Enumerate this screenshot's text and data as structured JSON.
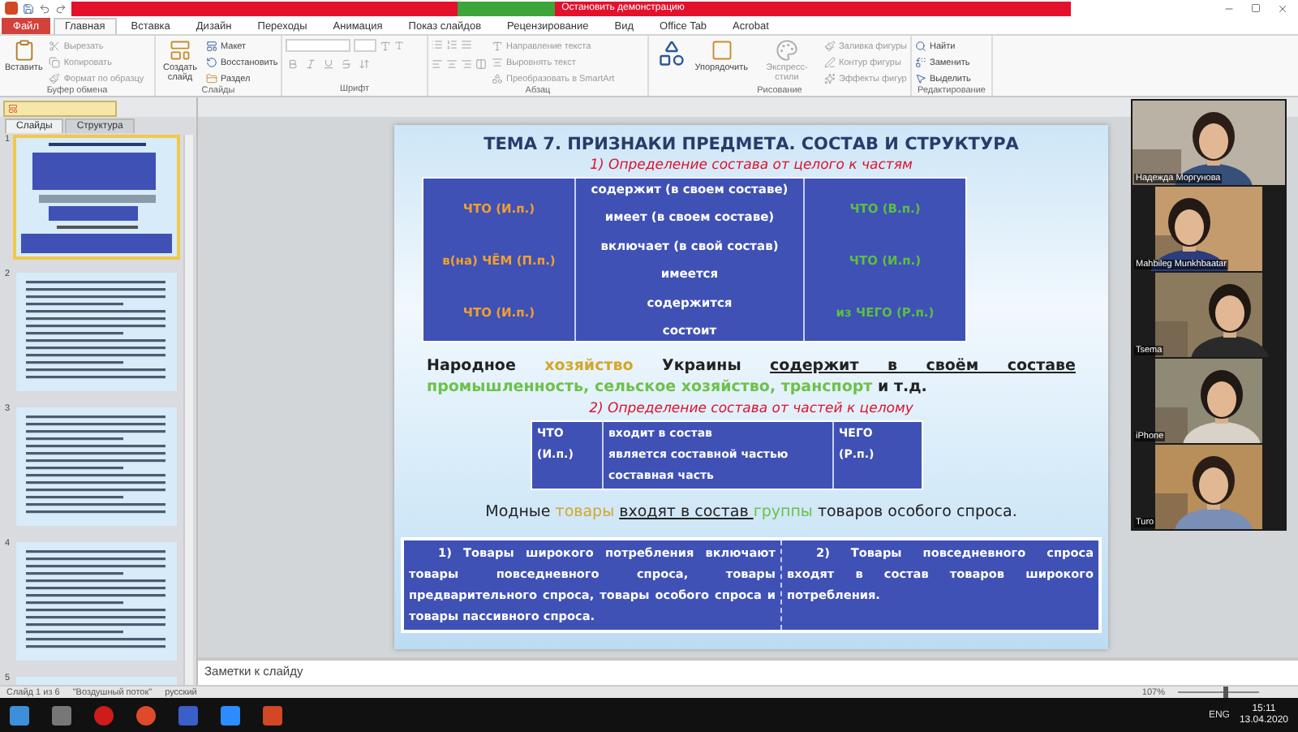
{
  "title_bar": {
    "share_label": "Остановить демонстрацию"
  },
  "ribbon": {
    "tabs": [
      {
        "label": "Файл",
        "selected": false,
        "kind": "file"
      },
      {
        "label": "Главная",
        "selected": true,
        "kind": "tab"
      },
      {
        "label": "Вставка",
        "selected": false,
        "kind": "tab"
      },
      {
        "label": "Дизайн",
        "selected": false,
        "kind": "tab"
      },
      {
        "label": "Переходы",
        "selected": false,
        "kind": "tab"
      },
      {
        "label": "Анимация",
        "selected": false,
        "kind": "tab"
      },
      {
        "label": "Показ слайдов",
        "selected": false,
        "kind": "tab"
      },
      {
        "label": "Рецензирование",
        "selected": false,
        "kind": "tab"
      },
      {
        "label": "Вид",
        "selected": false,
        "kind": "tab"
      },
      {
        "label": "Office Tab",
        "selected": false,
        "kind": "tab"
      },
      {
        "label": "Acrobat",
        "selected": false,
        "kind": "tab"
      }
    ],
    "clipboard": {
      "caption": "Буфер обмена",
      "paste": "Вставить",
      "cut": "Вырезать",
      "copy": "Копировать",
      "format": "Формат по образцу"
    },
    "slides": {
      "caption": "Слайды",
      "new_slide": "Создать слайд",
      "layout": "Макет",
      "reset": "Восстановить",
      "section": "Раздел"
    },
    "font": {
      "caption": "Шрифт"
    },
    "paragraph": {
      "caption": "Абзац",
      "direction": "Направление текста",
      "align": "Выровнять текст",
      "smartart": "Преобразовать в SmartArt"
    },
    "drawing": {
      "caption": "Рисование",
      "arrange": "Упорядочить",
      "styles": "Экспресс-стили",
      "fill": "Заливка фигуры",
      "outline": "Контур фигуры",
      "effects": "Эффекты фигур"
    },
    "editing": {
      "caption": "Редактирование",
      "find": "Найти",
      "replace": "Заменить",
      "select": "Выделить"
    }
  },
  "side_panel": {
    "tabs": [
      {
        "label": "Слайды",
        "selected": true
      },
      {
        "label": "Структура",
        "selected": false
      }
    ],
    "thumbnails": [
      {
        "number": "1",
        "selected": true,
        "kind": "title"
      },
      {
        "number": "2",
        "selected": false,
        "kind": "text"
      },
      {
        "number": "3",
        "selected": false,
        "kind": "text"
      },
      {
        "number": "4",
        "selected": false,
        "kind": "text"
      },
      {
        "number": "5",
        "selected": false,
        "kind": "text"
      }
    ]
  },
  "slide": {
    "title": "ТЕМА 7. ПРИЗНАКИ ПРЕДМЕТА. СОСТАВ И СТРУКТУРА",
    "heading_1": "1) Определение состава от целого к частям",
    "table_1": [
      {
        "color": "#f0a030",
        "cells": [
          "ЧТО  (И.п.)",
          "в(на) ЧЁМ (П.п.)",
          "ЧТО  (И.п.)"
        ]
      },
      {
        "color": "#ffffff",
        "cells": [
          "содержит (в своем составе)",
          "имеет (в своем составе)",
          "включает (в свой состав)",
          "имеется",
          "содержится",
          "состоит"
        ]
      },
      {
        "color": "#5cc040",
        "cells": [
          "ЧТО (В.п.)",
          "ЧТО (И.п.)",
          "из ЧЕГО  (Р.п.)"
        ]
      }
    ],
    "sentence_1": [
      {
        "text": "Народное ",
        "color": "#222222",
        "underline": false
      },
      {
        "text": "хозяйство",
        "color": "#d4a72c",
        "underline": false
      },
      {
        "text": " Украины ",
        "color": "#222222",
        "underline": false
      },
      {
        "text": "содержит в своём составе",
        "color": "#222222",
        "underline": true
      },
      {
        "text": " промышленность, сельское хозяйство, транспорт",
        "color": "#6cc24a",
        "underline": false
      },
      {
        "text": " и т.д.",
        "color": "#222222",
        "underline": false
      }
    ],
    "heading_2": "2) Определение состава от частей к целому",
    "table_2": [
      [
        "ЧТО",
        "(И.п.)"
      ],
      [
        "входит в состав",
        "является составной частью",
        "составная часть"
      ],
      [
        "ЧЕГО",
        "(Р.п.)"
      ]
    ],
    "sentence_2": [
      {
        "text": "Модные ",
        "color": "#222222",
        "underline": false
      },
      {
        "text": "товары ",
        "color": "#d4a72c",
        "underline": false
      },
      {
        "text": "входят в состав ",
        "color": "#222222",
        "underline": true
      },
      {
        "text": "группы",
        "color": "#6cc24a",
        "underline": false
      },
      {
        "text": " товаров особого спроса.",
        "color": "#222222",
        "underline": false
      }
    ],
    "table_3": [
      "1) Товары широкого потребления включают товары повседневного спроса, товары предварительного спроса, товары особого спроса и товары пассивного спроса.",
      "2) Товары повседневного спроса входят в состав товаров широкого потребления."
    ]
  },
  "participants": [
    {
      "name": "Надежда Моргунова"
    },
    {
      "name": "Mahbileg Munkhbaatar"
    },
    {
      "name": "Tsema"
    },
    {
      "name": "iPhone"
    },
    {
      "name": "Turo"
    }
  ],
  "notes": {
    "placeholder": "Заметки к слайду"
  },
  "status_bar": {
    "slide": "Слайд 1 из 6",
    "theme": "\"Воздушный поток\"",
    "language": "русский",
    "zoom": "107%",
    "level": 0.55
  },
  "taskbar": {
    "language": "ENG",
    "time": "15:11",
    "date": "13.04.2020"
  }
}
